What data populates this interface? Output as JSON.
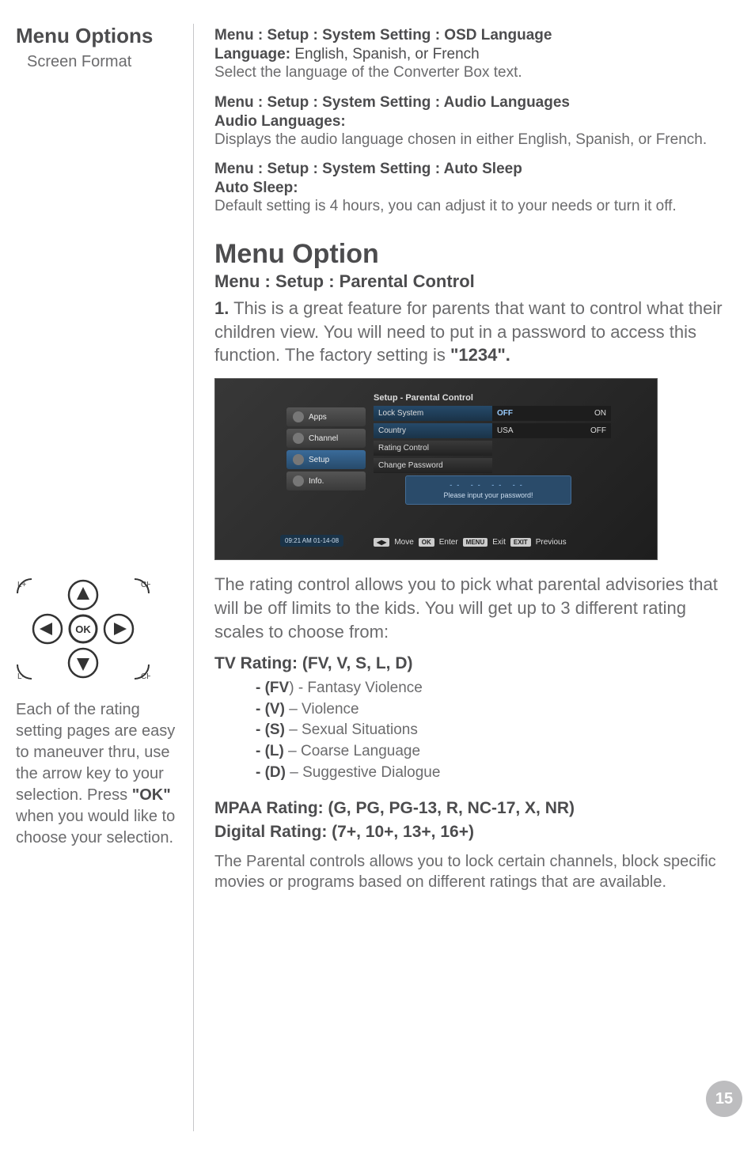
{
  "sidebar": {
    "title": "Menu Options",
    "subtitle": "Screen Format",
    "dpad_labels": {
      "vol_up": "L+",
      "vol_down": "L-",
      "ch": "CH",
      "ch2": "CH",
      "ok": "OK"
    },
    "note_parts": {
      "p1": "Each of the rating setting pages are easy to maneuver thru, use the arrow key to your selection. Press ",
      "ok": "\"OK\"",
      "p2": " when you would like to choose your selection."
    }
  },
  "settings": [
    {
      "path": "Menu  :  Setup  :  System Setting  :  OSD Language",
      "label": "Language:",
      "inline": " English, Spanish, or French",
      "desc": "Select the language of the Converter Box text."
    },
    {
      "path": "Menu  :  Setup  :  System Setting  :  Audio Languages",
      "label": "Audio Languages:",
      "inline": "",
      "desc": "Displays the audio language chosen in either English, Spanish, or French."
    },
    {
      "path": "Menu  :  Setup  :  System Setting  :  Auto Sleep",
      "label": "Auto Sleep:",
      "inline": "",
      "desc": "Default setting is 4 hours, you can adjust it to your needs or turn it off."
    }
  ],
  "menu_option": {
    "heading": "Menu Option",
    "path": "Menu  :  Setup  :  Parental Control",
    "step_num": "1.",
    "step_body": " This is a great feature for parents that want to control what their children view. You will need to put in a password to access this function. The factory setting is ",
    "password": "\"1234\"."
  },
  "screenshot": {
    "panel_title": "Setup - Parental Control",
    "tabs": [
      "Apps",
      "Channel",
      "Setup",
      "Info."
    ],
    "rows": [
      {
        "k": "Lock System",
        "v1": "OFF",
        "v2": "ON",
        "hl": true
      },
      {
        "k": "Country",
        "v1": "USA",
        "v2": "OFF",
        "hl": false
      },
      {
        "k": "Rating Control",
        "v1": "",
        "v2": "",
        "hl": false,
        "dark": true
      },
      {
        "k": "Change Password",
        "v1": "",
        "v2": "",
        "hl": false,
        "dark": true
      }
    ],
    "prompt_dashes": "-- -- -- --",
    "prompt_text": "Please input your password!",
    "timestamp": "09:21 AM 01-14-08",
    "footer": {
      "move": "Move",
      "ok": "OK",
      "enter": "Enter",
      "menu": "MENU",
      "exit": "Exit",
      "exit_key": "EXIT",
      "previous": "Previous"
    }
  },
  "rating_intro": "The rating control allows you to pick what parental advisories that will be off limits to the kids. You will get up to 3 different rating scales to choose from:",
  "tv_rating": {
    "heading": "TV Rating: (FV, V, S, L, D)",
    "items": [
      {
        "code": "- (FV",
        "tail": ") - Fantasy Violence"
      },
      {
        "code": "- (V)",
        "tail": " – Violence"
      },
      {
        "code": "- (S)",
        "tail": " – Sexual Situations"
      },
      {
        "code": "- (L)",
        "tail": " – Coarse Language"
      },
      {
        "code": "- (D)",
        "tail": " – Suggestive Dialogue"
      }
    ]
  },
  "mpaa_heading": "MPAA Rating: (G, PG, PG-13, R, NC-17, X, NR)",
  "digital_heading": "Digital Rating: (7+, 10+, 13+, 16+)",
  "closing": "The Parental controls allows you to lock certain channels, block specific movies or programs based on different ratings that are available.",
  "page_number": "15"
}
